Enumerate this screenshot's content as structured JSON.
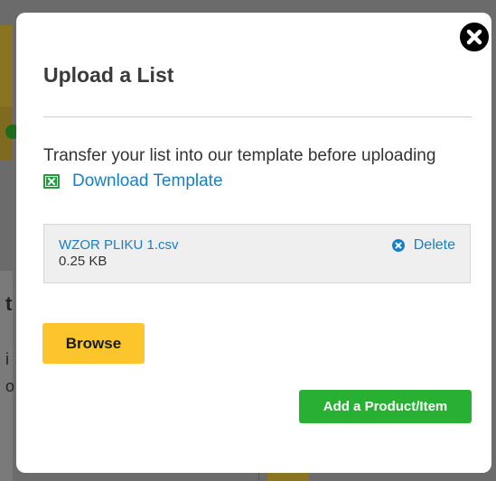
{
  "background": {
    "side_text_1": "t",
    "side_text_2": "i",
    "side_text_3": "o"
  },
  "modal": {
    "title": "Upload a List",
    "instructions": "Transfer your list into our template before uploading",
    "download_template_label": "Download Template",
    "file": {
      "name": "WZOR PLIKU 1.csv",
      "size": "0.25 KB",
      "delete_label": "Delete"
    },
    "browse_label": "Browse",
    "add_product_label": "Add a Product/Item"
  },
  "colors": {
    "link": "#1a7ec4",
    "browse_button": "#fcc52c",
    "add_button": "#28b032",
    "excel_icon": "#1f9e3a"
  },
  "icons": {
    "close": "close-icon",
    "excel": "excel-icon",
    "delete": "circle-x-icon"
  }
}
